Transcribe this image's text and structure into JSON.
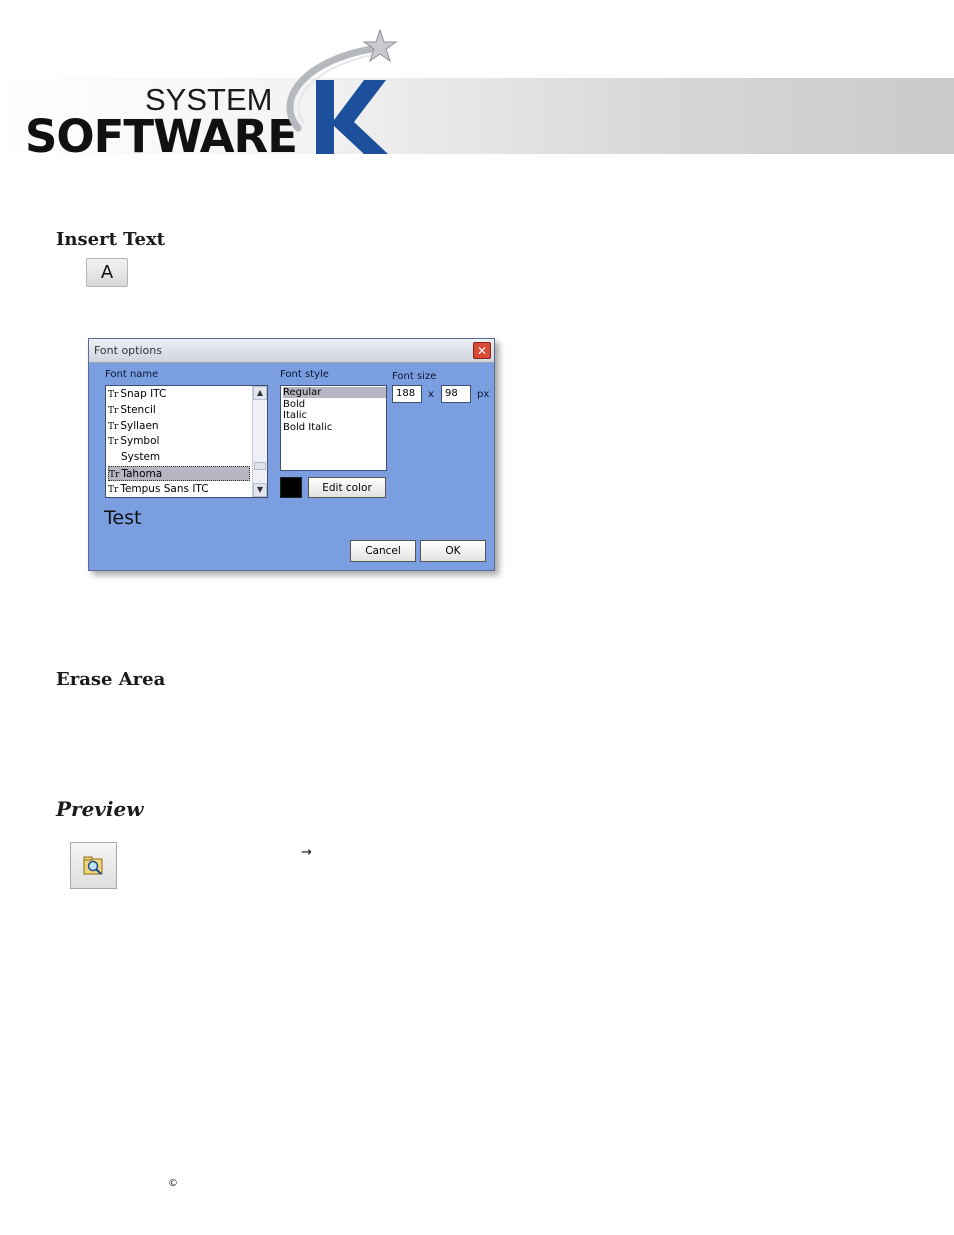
{
  "header": {
    "logo_line1": "SYSTEM",
    "logo_line2": "SOFTWARE",
    "logo_letter": "K",
    "brand_blue": "#1c4f9c"
  },
  "sections": {
    "insert_text": "Insert Text",
    "erase_area": "Erase Area",
    "preview": "Preview"
  },
  "toolbar": {
    "text_tool_glyph": "A"
  },
  "dialog": {
    "title": "Font options",
    "font_name_label": "Font name",
    "font_style_label": "Font style",
    "font_size_label": "Font size",
    "fonts": [
      {
        "name": "Snap ITC",
        "truetype": true,
        "selected": false
      },
      {
        "name": "Stencil",
        "truetype": true,
        "selected": false
      },
      {
        "name": "Syllaen",
        "truetype": true,
        "selected": false
      },
      {
        "name": "Symbol",
        "truetype": true,
        "selected": false
      },
      {
        "name": "System",
        "truetype": false,
        "selected": false
      },
      {
        "name": "Tahoma",
        "truetype": true,
        "selected": true
      },
      {
        "name": "Tempus Sans ITC",
        "truetype": true,
        "selected": false
      }
    ],
    "styles": [
      "Regular",
      "Bold",
      "Italic",
      "Bold Italic"
    ],
    "selected_style": "Regular",
    "size_width": "188",
    "size_x": "x",
    "size_height": "98",
    "size_unit": "px",
    "edit_color_label": "Edit color",
    "color_value": "#000000",
    "preview_text": "Test",
    "cancel_label": "Cancel",
    "ok_label": "OK",
    "background_color": "#7a9ee0"
  },
  "preview_section": {
    "arrow": "→"
  },
  "footer": {
    "copyright": "©"
  }
}
